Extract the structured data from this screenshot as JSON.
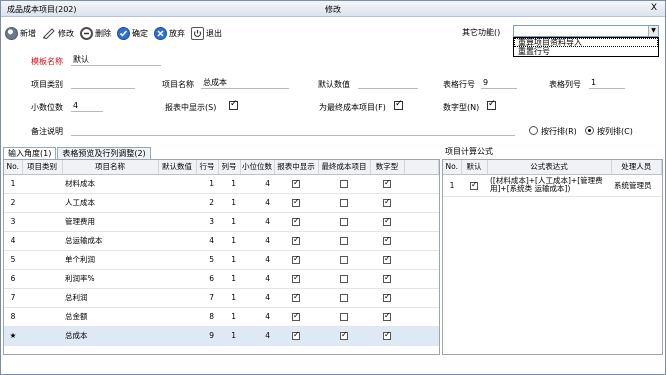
{
  "window": {
    "title": "成品成本项目(202)",
    "mode": "修改",
    "close": "X"
  },
  "toolbar": {
    "new_label": "新增",
    "edit_label": "修改",
    "delete_label": "删除",
    "confirm_label": "确定",
    "cancel_label": "放弃",
    "exit_label": "退出"
  },
  "func": {
    "label": "其它功能()",
    "options": [
      "重算项目资料导入",
      "重置行号"
    ]
  },
  "form": {
    "template_label": "模板名称",
    "template_value": "默认",
    "category_label": "项目类别",
    "category_value": "",
    "name_label": "项目名称",
    "name_value": "总成本",
    "default_label": "默认数值",
    "default_value": "",
    "row_label": "表格行号",
    "row_value": "9",
    "col_label": "表格列号",
    "col_value": "1",
    "decimals_label": "小数位数",
    "decimals_value": "4",
    "show_label": "报表中显示(S)",
    "show_checked": true,
    "final_label": "为最终成本项目(F)",
    "final_checked": true,
    "numeric_label": "数字型(N)",
    "numeric_checked": true,
    "note_label": "备注说明",
    "note_value": "",
    "by_row_label": "按行排(R)",
    "by_row_selected": false,
    "by_col_label": "按列排(C)",
    "by_col_selected": true
  },
  "tabs": [
    "输入角度(1)",
    "表格预览及行列调整(2)"
  ],
  "right_title": "项目计算公式",
  "left_grid": {
    "headers": [
      "No.",
      "项目类别",
      "项目名称",
      "默认数值",
      "行号",
      "列号",
      "小位位数",
      "报表中显示",
      "最终成本项目",
      "数字型"
    ],
    "rows": [
      {
        "no": "1",
        "category": "",
        "name": "材料成本",
        "default": "",
        "row": "1",
        "col": "1",
        "decimals": "4",
        "show": true,
        "final": false,
        "numeric": true
      },
      {
        "no": "2",
        "category": "",
        "name": "人工成本",
        "default": "",
        "row": "2",
        "col": "1",
        "decimals": "4",
        "show": true,
        "final": false,
        "numeric": true
      },
      {
        "no": "3",
        "category": "",
        "name": "管理费用",
        "default": "",
        "row": "3",
        "col": "1",
        "decimals": "4",
        "show": true,
        "final": false,
        "numeric": true
      },
      {
        "no": "4",
        "category": "",
        "name": "总运输成本",
        "default": "",
        "row": "4",
        "col": "1",
        "decimals": "4",
        "show": true,
        "final": false,
        "numeric": true
      },
      {
        "no": "5",
        "category": "",
        "name": "单个利润",
        "default": "",
        "row": "5",
        "col": "1",
        "decimals": "4",
        "show": true,
        "final": false,
        "numeric": true
      },
      {
        "no": "6",
        "category": "",
        "name": "利润率%",
        "default": "",
        "row": "6",
        "col": "1",
        "decimals": "4",
        "show": true,
        "final": false,
        "numeric": true
      },
      {
        "no": "7",
        "category": "",
        "name": "总利润",
        "default": "",
        "row": "7",
        "col": "1",
        "decimals": "4",
        "show": true,
        "final": false,
        "numeric": true
      },
      {
        "no": "8",
        "category": "",
        "name": "总金额",
        "default": "",
        "row": "8",
        "col": "1",
        "decimals": "4",
        "show": true,
        "final": false,
        "numeric": true
      },
      {
        "no": "★",
        "category": "",
        "name": "总成本",
        "default": "",
        "row": "9",
        "col": "1",
        "decimals": "4",
        "show": true,
        "final": true,
        "numeric": true
      }
    ]
  },
  "right_grid": {
    "headers": [
      "No.",
      "默认",
      "公式表达式",
      "处理人员"
    ],
    "rows": [
      {
        "no": "1",
        "default": true,
        "formula": "([材料成本]+[人工成本]+[管理费用]+[系统类 运输成本])",
        "user": "系统管理员"
      }
    ]
  }
}
